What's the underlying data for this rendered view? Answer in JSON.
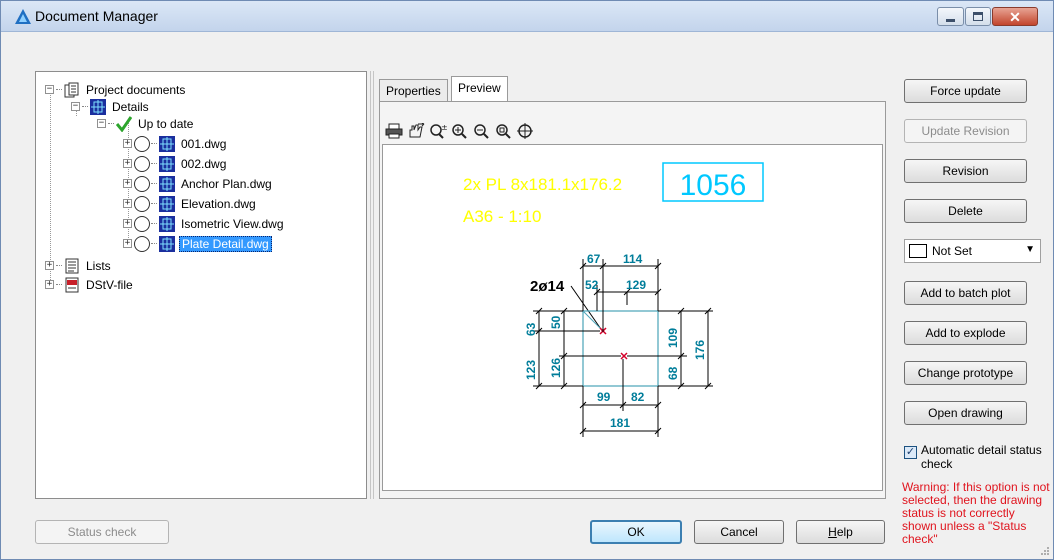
{
  "window": {
    "title": "Document Manager"
  },
  "tree": {
    "root": "Project documents",
    "details": "Details",
    "status_group": "Up to date",
    "files": [
      "001.dwg",
      "002.dwg",
      "Anchor Plan.dwg",
      "Elevation.dwg",
      "Isometric View.dwg",
      "Plate Detail.dwg"
    ],
    "selected_file": "Plate Detail.dwg",
    "lists": "Lists",
    "dstv": "DStV-file"
  },
  "tabs": {
    "properties": "Properties",
    "preview": "Preview",
    "active": "Preview"
  },
  "preview": {
    "toolbar_icons": [
      "print-icon",
      "pan-icon",
      "zoom-realtime-icon",
      "zoom-in-icon",
      "zoom-out-icon",
      "zoom-window-icon",
      "zoom-extents-icon"
    ],
    "title_line1": "2x PL 8x181.1x176.2",
    "title_line2": "A36 - 1:10",
    "part_number": "1056",
    "hole_label": "2ø14",
    "dims": {
      "d67": "67",
      "d114": "114",
      "d52": "52",
      "d129": "129",
      "d63": "63",
      "d50": "50",
      "d123": "123",
      "d126": "126",
      "d109": "109",
      "d68": "68",
      "d176": "176",
      "d99": "99",
      "d82": "82",
      "d181": "181"
    },
    "colors": {
      "title": "#ffff00",
      "part_number": "#00c8ff",
      "dimension": "#007d9a",
      "outline": "#4aa3b8",
      "hole": "#d4002a"
    }
  },
  "buttons": {
    "force_update": "Force update",
    "update_revision": "Update Revision",
    "revision": "Revision",
    "delete": "Delete",
    "add_to_batch_plot": "Add to batch plot",
    "add_to_explode": "Add to explode",
    "change_prototype": "Change prototype",
    "open_drawing": "Open drawing"
  },
  "color_select": {
    "value": "Not Set"
  },
  "auto_check": {
    "label": "Automatic detail status check",
    "checked": true
  },
  "warning": "Warning: If this option is not selected, then the drawing status is not correctly shown unless a \"Status check\" ",
  "footer": {
    "status_check": "Status check",
    "ok": "OK",
    "cancel": "Cancel",
    "help_first": "H",
    "help_rest": "elp"
  }
}
